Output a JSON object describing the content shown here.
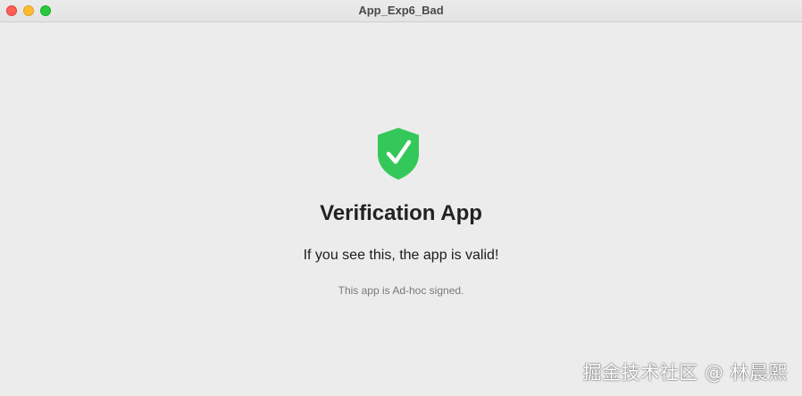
{
  "window": {
    "title": "App_Exp6_Bad",
    "controls": {
      "close": "close-button",
      "minimize": "minimize-button",
      "zoom": "zoom-button"
    }
  },
  "main": {
    "icon": "shield-check-icon",
    "icon_color": "#34c759",
    "heading": "Verification App",
    "message": "If you see this, the app is valid!",
    "note": "This app is Ad-hoc signed."
  },
  "watermark": {
    "text": "掘金技术社区 @ 林晨熙"
  }
}
